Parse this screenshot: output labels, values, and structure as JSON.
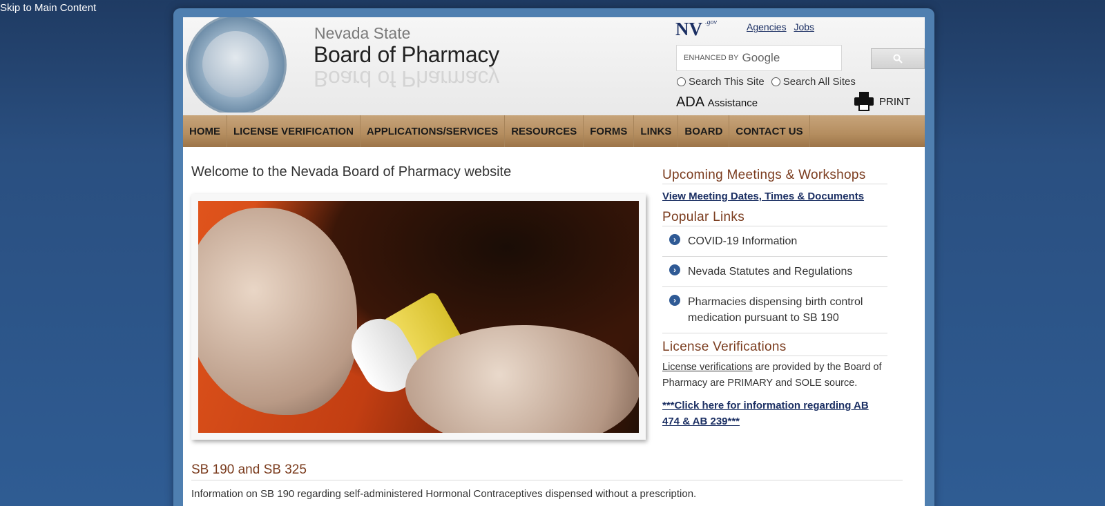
{
  "skip_link": "Skip to Main Content",
  "header": {
    "state": "Nevada State",
    "board": "Board of Pharmacy",
    "nv_logo": "NV",
    "nv_gov": ".gov",
    "top_links": [
      "Agencies",
      "Jobs"
    ],
    "search": {
      "enhanced_by": "ENHANCED BY",
      "google": "Google",
      "value": ""
    },
    "radios": [
      "Search This Site",
      "Search All Sites"
    ],
    "ada_big": "ADA",
    "ada_small": "Assistance",
    "print": "PRINT"
  },
  "nav": [
    "HOME",
    "LICENSE VERIFICATION",
    "APPLICATIONS/SERVICES",
    "RESOURCES",
    "FORMS",
    "LINKS",
    "BOARD",
    "CONTACT US"
  ],
  "main": {
    "welcome": "Welcome to the Nevada Board of Pharmacy website",
    "section_title": "SB 190 and SB 325",
    "section_text": "Information on SB 190 regarding self-administered Hormonal Contraceptives dispensed without a prescription."
  },
  "sidebar": {
    "meetings_head": "Upcoming Meetings & Workshops",
    "meetings_link": "View Meeting Dates, Times & Documents",
    "popular_head": "Popular Links",
    "popular": [
      "COVID-19 Information",
      "Nevada Statutes and Regulations",
      "Pharmacies dispensing birth control medication pursuant to SB 190"
    ],
    "license_head": "License Verifications",
    "license_link": "License verifications",
    "license_text": " are provided by the Board of Pharmacy are PRIMARY and SOLE source.",
    "ab_link": "***Click here for information regarding AB 474 & AB 239***"
  },
  "colors": {
    "brand_blue": "#1b2f63",
    "nav_tan": "#b48d5f",
    "heading_brown": "#7a3b1d"
  }
}
